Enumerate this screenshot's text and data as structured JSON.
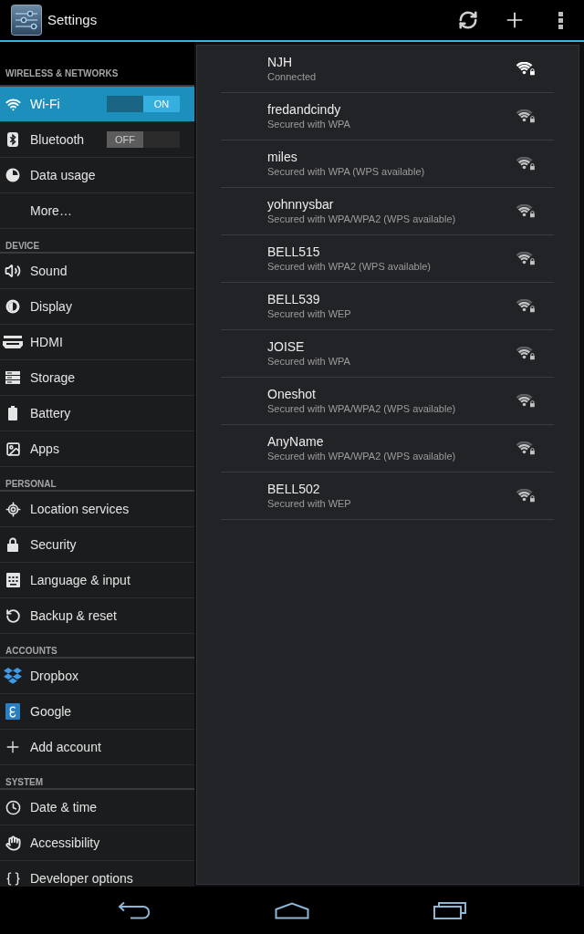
{
  "action_bar": {
    "title": "Settings"
  },
  "sidebar": {
    "sections": [
      {
        "header": "WIRELESS & NETWORKS",
        "items": [
          {
            "label": "Wi-Fi",
            "selected": true,
            "switch": {
              "on": true,
              "label": "ON"
            }
          },
          {
            "label": "Bluetooth",
            "selected": false,
            "switch": {
              "on": false,
              "label": "OFF"
            }
          },
          {
            "label": "Data usage",
            "selected": false
          },
          {
            "label": "More…",
            "selected": false
          }
        ]
      },
      {
        "header": "DEVICE",
        "items": [
          {
            "label": "Sound",
            "selected": false
          },
          {
            "label": "Display",
            "selected": false
          },
          {
            "label": "HDMI",
            "selected": false
          },
          {
            "label": "Storage",
            "selected": false
          },
          {
            "label": "Battery",
            "selected": false
          },
          {
            "label": "Apps",
            "selected": false
          }
        ]
      },
      {
        "header": "PERSONAL",
        "items": [
          {
            "label": "Location services",
            "selected": false
          },
          {
            "label": "Security",
            "selected": false
          },
          {
            "label": "Language & input",
            "selected": false
          },
          {
            "label": "Backup & reset",
            "selected": false
          }
        ]
      },
      {
        "header": "ACCOUNTS",
        "items": [
          {
            "label": "Dropbox",
            "selected": false
          },
          {
            "label": "Google",
            "selected": false
          },
          {
            "label": "Add account",
            "selected": false
          }
        ]
      },
      {
        "header": "SYSTEM",
        "items": [
          {
            "label": "Date & time",
            "selected": false
          },
          {
            "label": "Accessibility",
            "selected": false
          },
          {
            "label": "Developer options",
            "selected": false
          }
        ]
      }
    ]
  },
  "networks": [
    {
      "name": "NJH",
      "status": "Connected",
      "connected": true
    },
    {
      "name": "fredandcindy",
      "status": "Secured with WPA",
      "connected": false
    },
    {
      "name": "miles",
      "status": "Secured with WPA (WPS available)",
      "connected": false
    },
    {
      "name": "yohnnysbar",
      "status": "Secured with WPA/WPA2 (WPS available)",
      "connected": false
    },
    {
      "name": "BELL515",
      "status": "Secured with WPA2 (WPS available)",
      "connected": false
    },
    {
      "name": "BELL539",
      "status": "Secured with WEP",
      "connected": false
    },
    {
      "name": "JOISE",
      "status": "Secured with WPA",
      "connected": false
    },
    {
      "name": "Oneshot",
      "status": "Secured with WPA/WPA2 (WPS available)",
      "connected": false
    },
    {
      "name": "AnyName",
      "status": "Secured with WPA/WPA2 (WPS available)",
      "connected": false
    },
    {
      "name": "BELL502",
      "status": "Secured with WEP",
      "connected": false
    }
  ]
}
